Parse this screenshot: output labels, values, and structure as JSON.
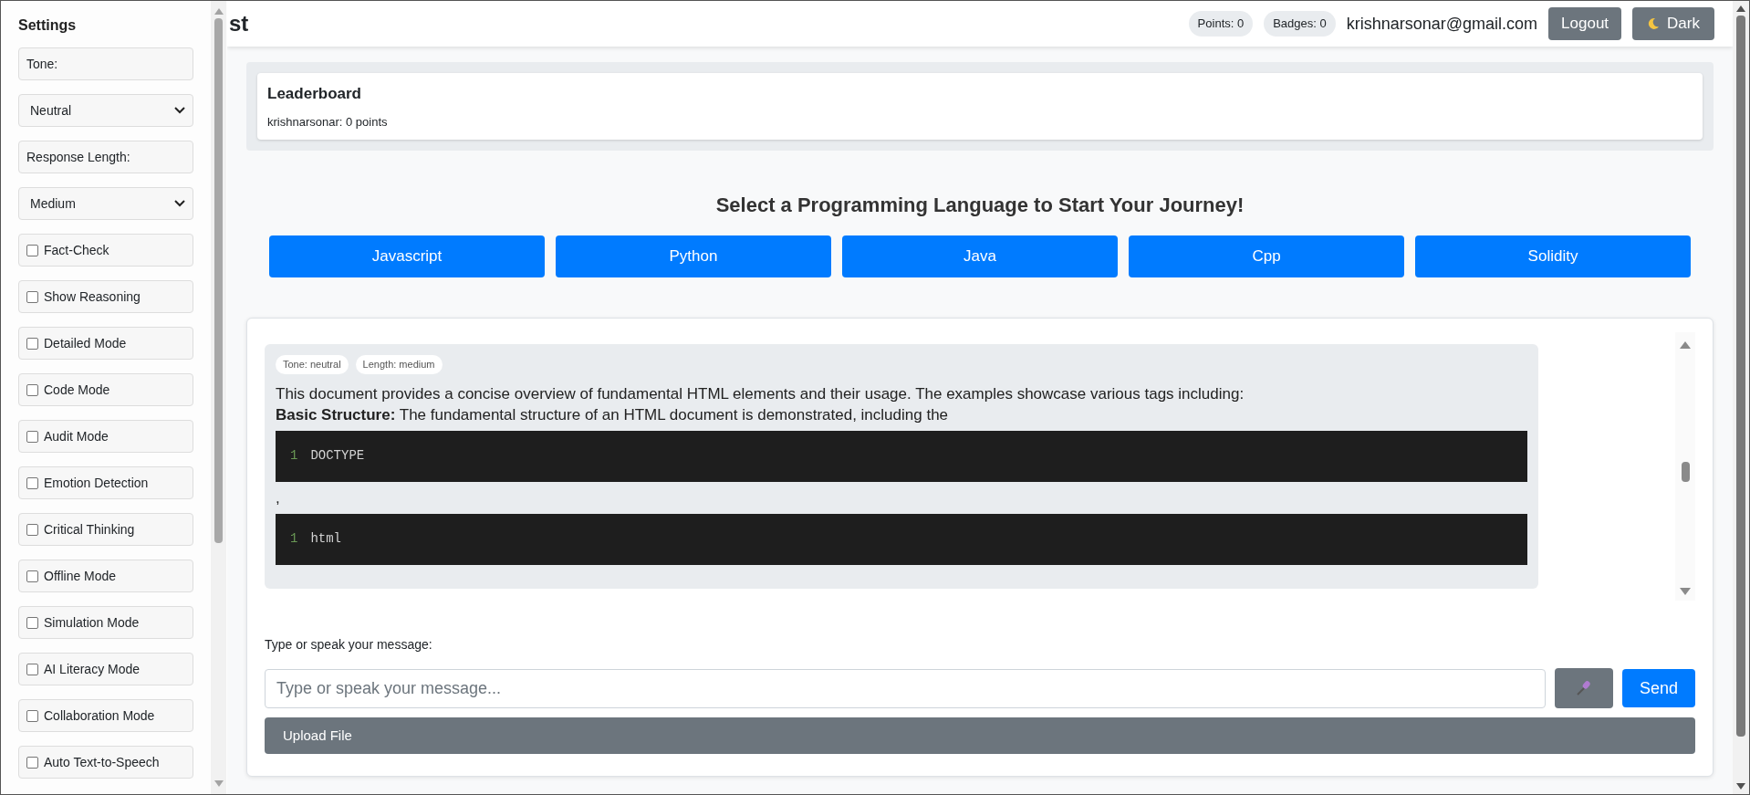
{
  "sidebar": {
    "title": "Settings",
    "items": [
      {
        "kind": "label",
        "label": "Tone:"
      },
      {
        "kind": "select",
        "value": "Neutral"
      },
      {
        "kind": "label",
        "label": "Response Length:"
      },
      {
        "kind": "select",
        "value": "Medium"
      },
      {
        "kind": "checkbox",
        "label": "Fact-Check",
        "checked": false
      },
      {
        "kind": "checkbox",
        "label": "Show Reasoning",
        "checked": false
      },
      {
        "kind": "checkbox",
        "label": "Detailed Mode",
        "checked": false
      },
      {
        "kind": "checkbox",
        "label": "Code Mode",
        "checked": false
      },
      {
        "kind": "checkbox",
        "label": "Audit Mode",
        "checked": false
      },
      {
        "kind": "checkbox",
        "label": "Emotion Detection",
        "checked": false
      },
      {
        "kind": "checkbox",
        "label": "Critical Thinking",
        "checked": false
      },
      {
        "kind": "checkbox",
        "label": "Offline Mode",
        "checked": false
      },
      {
        "kind": "checkbox",
        "label": "Simulation Mode",
        "checked": false
      },
      {
        "kind": "checkbox",
        "label": "AI Literacy Mode",
        "checked": false
      },
      {
        "kind": "checkbox",
        "label": "Collaboration Mode",
        "checked": false
      },
      {
        "kind": "checkbox",
        "label": "Auto Text-to-Speech",
        "checked": false
      }
    ]
  },
  "header": {
    "title": "st",
    "points": "Points: 0",
    "badges": "Badges: 0",
    "email": "krishnarsonar@gmail.com",
    "logout": "Logout",
    "theme_button": "Dark"
  },
  "leaderboard": {
    "title": "Leaderboard",
    "entries": [
      "krishnarsonar: 0 points"
    ]
  },
  "languages": {
    "heading": "Select a Programming Language to Start Your Journey!",
    "buttons": [
      "Javascript",
      "Python",
      "Java",
      "Cpp",
      "Solidity"
    ]
  },
  "chat": {
    "messages": [
      {
        "tags": [
          "Tone: neutral",
          "Length: medium"
        ],
        "blocks": [
          {
            "kind": "text",
            "text": "This document provides a concise overview of fundamental HTML elements and their usage. The examples showcase various tags including:"
          },
          {
            "kind": "text",
            "text": "**Basic Structure:** The fundamental structure of an HTML document is demonstrated, including the"
          },
          {
            "kind": "code",
            "lines": [
              {
                "number": "1",
                "code": "DOCTYPE"
              }
            ]
          },
          {
            "kind": "text",
            "text": ","
          },
          {
            "kind": "code",
            "lines": [
              {
                "number": "1",
                "code": "html"
              }
            ]
          }
        ]
      }
    ],
    "input_label": "Type or speak your message:",
    "placeholder": "Type or speak your message...",
    "send": "Send",
    "upload": "Upload File"
  }
}
